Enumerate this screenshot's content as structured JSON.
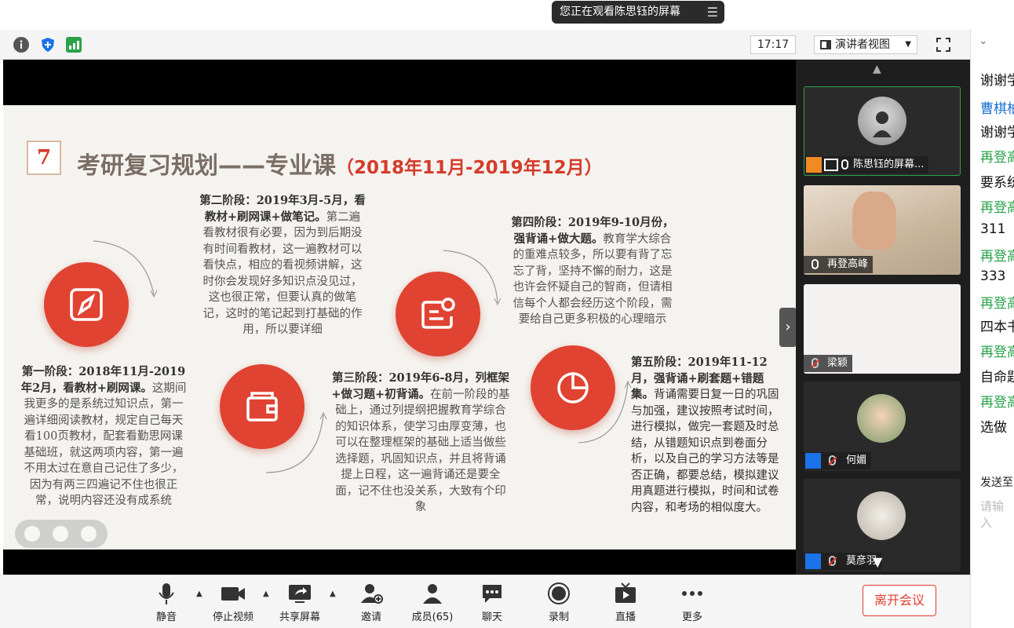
{
  "banner": {
    "text": "您正在观看陈思钰的屏幕",
    "menu_icon": "list-icon"
  },
  "toolbar": {
    "time": "17:17",
    "view_mode": "演讲者视图"
  },
  "slide": {
    "number": "7",
    "title": "考研复习规划——专业课",
    "title_range": "（2018年11月-2019年12月）",
    "stage1_head": "第一阶段：2018年11月-2019年2月，看教材+刷网课。",
    "stage1_body": "这期间我更多的是系统过知识点，第一遍详细阅读教材，规定自己每天看100页教材，配套看勤思网课基础班，就这两项内容，第一遍不用太过在意自己记住了多少，因为有两三四遍记不住也很正常，说明内容还没有成系统",
    "stage2_head": "第二阶段：2019年3月-5月，看教材+刷网课+做笔记。",
    "stage2_body": "第二遍看教材很有必要，因为到后期没有时间看教材，这一遍教材可以看快点，相应的看视频讲解，这时你会发现好多知识点没见过，这也很正常，但要认真的做笔记，这时的笔记起到打基础的作用，所以要详细",
    "stage3_head": "第三阶段：2019年6-8月，列框架+做习题+初背诵。",
    "stage3_body": "在前一阶段的基础上，通过列提纲把握教育学综合的知识体系，使学习由厚变薄，也可以在整理框架的基础上适当做些选择题，巩固知识点，并且将背诵提上日程，这一遍背诵还是要全面，记不住也没关系，大致有个印象",
    "stage4_head": "第四阶段：2019年9-10月份，强背诵+做大题。",
    "stage4_body": "教育学大综合的重难点较多，所以要有背了忘忘了背，坚持不懈的耐力，这是也许会怀疑自己的智商，但请相信每个人都会经历这个阶段，需要给自己更多积极的心理暗示",
    "stage5_head": "第五阶段：2019年11-12月，强背诵+刷套题+错题集。",
    "stage5_body": "背诵需要日复一日的巩固与加强，建议按照考试时间，进行模拟，做完一套题及时总结，从错题知识点到卷面分析，以及自己的学习方法等是否正确，都要总结，模拟建议用真题进行模拟，时间和试卷内容，和考场的相似度大。"
  },
  "participants": [
    {
      "name": "陈思钰的屏幕...",
      "avatar": "silhouette",
      "mic": "on"
    },
    {
      "name": "再登高峰",
      "avatar": "video",
      "mic": "on"
    },
    {
      "name": "梁颖",
      "avatar": "blank",
      "mic": "muted"
    },
    {
      "name": "何媚",
      "avatar": "photo",
      "mic": "muted"
    },
    {
      "name": "莫彦羽",
      "avatar": "photo-cat",
      "mic": "muted"
    }
  ],
  "chat": {
    "lines": [
      {
        "text": "谢谢学",
        "style": "normal"
      },
      {
        "text": "曹棋柚",
        "style": "blue"
      },
      {
        "text": "谢谢学",
        "style": "normal"
      },
      {
        "text": "再登高",
        "style": "green"
      },
      {
        "text": "要系统",
        "style": "normal"
      },
      {
        "text": "再登高",
        "style": "green"
      },
      {
        "text": "311",
        "style": "normal"
      },
      {
        "text": "再登高",
        "style": "green"
      },
      {
        "text": "333",
        "style": "normal"
      },
      {
        "text": "再登高",
        "style": "green"
      },
      {
        "text": "四本书",
        "style": "normal"
      },
      {
        "text": "再登高",
        "style": "green"
      },
      {
        "text": "自命题",
        "style": "normal"
      },
      {
        "text": "再登高",
        "style": "green"
      },
      {
        "text": "选做",
        "style": "normal"
      }
    ],
    "send_to": "发送至",
    "input_placeholder": "请输入"
  },
  "bottom": {
    "mute": "静音",
    "stop_video": "停止视频",
    "share_screen": "共享屏幕",
    "invite": "邀请",
    "members": "成员(65)",
    "chat": "聊天",
    "record": "录制",
    "live": "直播",
    "more": "更多",
    "leave": "离开会议"
  },
  "colors": {
    "accent_red": "#e04332",
    "green": "#2aa24a",
    "blue_shield": "#1a73e8"
  }
}
